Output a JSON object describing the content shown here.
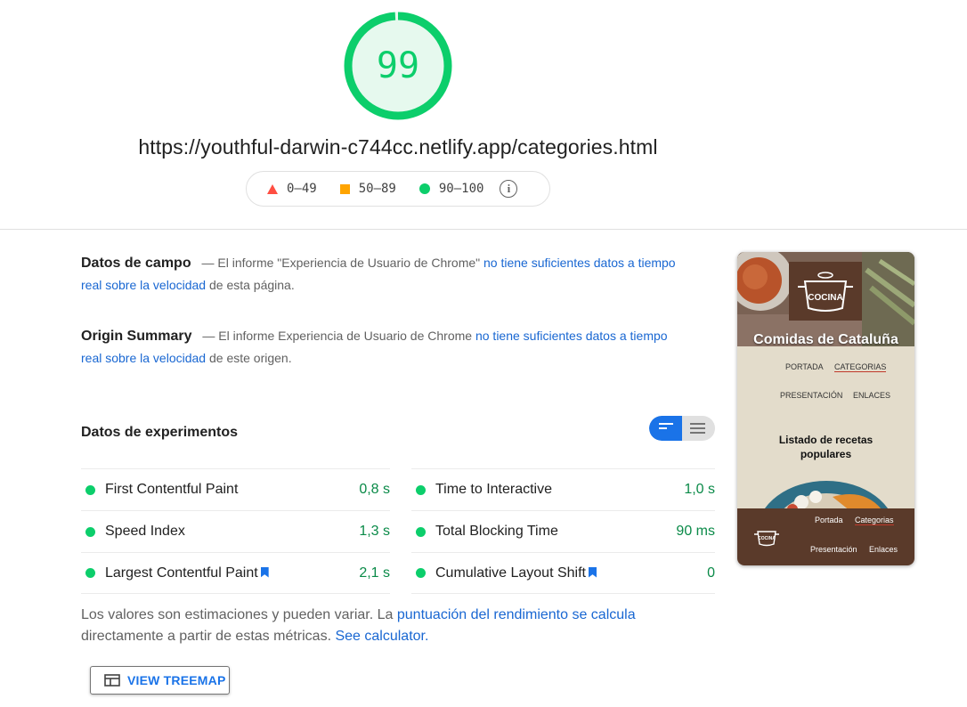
{
  "score": {
    "value": "99",
    "fraction": 0.99,
    "color": "#0cce6b"
  },
  "url": "https://youthful-darwin-c744cc.netlify.app/categories.html",
  "legend": {
    "ranges": [
      {
        "label": "0–49",
        "color": "#ff4e42",
        "icon": "triangle-icon"
      },
      {
        "label": "50–89",
        "color": "#ffa400",
        "icon": "square-icon"
      },
      {
        "label": "90–100",
        "color": "#0cce6b",
        "icon": "circle-icon"
      }
    ],
    "info_icon": "i"
  },
  "field_data": {
    "title": "Datos de campo",
    "text_before": "— El informe \"Experiencia de Usuario de Chrome\"",
    "link": "no tiene suficientes datos a tiempo real sobre la velocidad",
    "text_after": "de esta página."
  },
  "origin_summary": {
    "title": "Origin Summary",
    "text_before": "— El informe Experiencia de Usuario de Chrome",
    "link": "no tiene suficientes datos a tiempo real sobre la velocidad",
    "text_after": "de este origen."
  },
  "lab_data": {
    "title": "Datos de experimentos"
  },
  "metrics": [
    {
      "label": "First Contentful Paint",
      "value": "0,8 s",
      "flag": false
    },
    {
      "label": "Time to Interactive",
      "value": "1,0 s",
      "flag": false
    },
    {
      "label": "Speed Index",
      "value": "1,3 s",
      "flag": false
    },
    {
      "label": "Total Blocking Time",
      "value": "90 ms",
      "flag": false
    },
    {
      "label": "Largest Contentful Paint",
      "value": "2,1 s",
      "flag": true
    },
    {
      "label": "Cumulative Layout Shift",
      "value": "0",
      "flag": true
    }
  ],
  "footer": {
    "text_before": "Los valores son estimaciones y pueden variar. La",
    "link1": "puntuación del rendimiento se calcula",
    "text_middle": "directamente a partir de estas métricas.",
    "link2": "See calculator."
  },
  "treemap_button": "VIEW TREEMAP",
  "thumbnail": {
    "logo_text": "COCINA",
    "brand": "Comidas de Cataluña",
    "nav": [
      "PORTADA",
      "CATEGORIAS",
      "PRESENTACIÓN",
      "ENLACES"
    ],
    "heading": "Listado de recetas populares",
    "footer_nav": [
      "Portada",
      "Categorias",
      "Presentación",
      "Enlaces"
    ],
    "footer_logo_text": "COCINA"
  }
}
